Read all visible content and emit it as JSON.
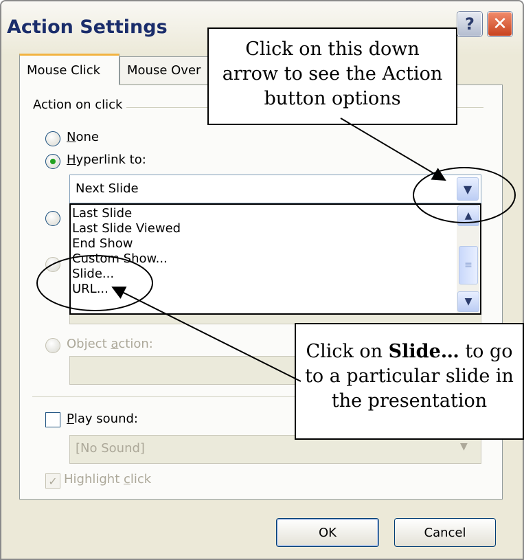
{
  "dialog": {
    "title": "Action Settings",
    "help_label": "?",
    "close_label": "✕"
  },
  "tabs": [
    {
      "label": "Mouse Click",
      "active": true
    },
    {
      "label": "Mouse Over",
      "active": false
    }
  ],
  "action_group": {
    "label": "Action on click",
    "none_label_u": "N",
    "none_label_rest": "one",
    "hyperlink_label_u": "H",
    "hyperlink_label_rest": "yperlink to:",
    "hyperlink_value": "Next Slide",
    "object_action_label": "Object action:",
    "object_action_u": "a",
    "object_action_pre": "Object ",
    "object_action_post": "ction:"
  },
  "dropdown_options": [
    "Last Slide",
    "Last Slide Viewed",
    "End Show",
    "Custom Show...",
    "Slide...",
    "URL..."
  ],
  "sound": {
    "play_label_u": "P",
    "play_label_rest": "lay sound:",
    "sound_value": "[No Sound]",
    "highlight_pre": "Highlight ",
    "highlight_u": "c",
    "highlight_post": "lick"
  },
  "buttons": {
    "ok": "OK",
    "cancel": "Cancel"
  },
  "callouts": {
    "top_line1": "Click on this down",
    "top_line2": "arrow to see the Action",
    "top_line3": "button options",
    "bottom_pre": "Click on ",
    "bottom_bold": "Slide…",
    "bottom_post": " to go",
    "bottom_line2": "to a particular slide in",
    "bottom_line3": "the presentation"
  },
  "colors": {
    "dialog_bg": "#ece9d8",
    "title_text": "#1a2d6b",
    "tab_accent": "#f2b340",
    "radio_dot": "#21a121"
  }
}
